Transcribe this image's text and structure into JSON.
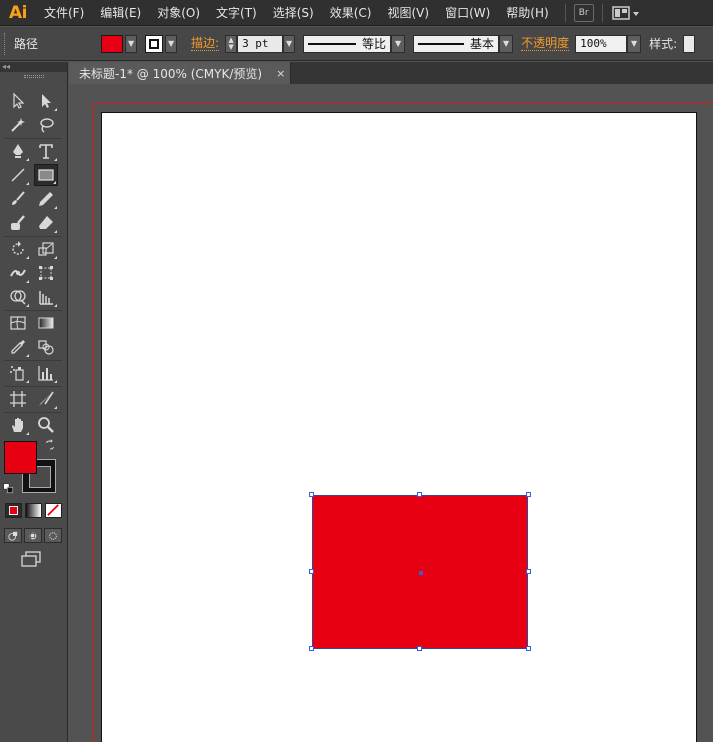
{
  "app": {
    "logo": "Ai"
  },
  "menu": {
    "items": [
      "文件(F)",
      "编辑(E)",
      "对象(O)",
      "文字(T)",
      "选择(S)",
      "效果(C)",
      "视图(V)",
      "窗口(W)",
      "帮助(H)"
    ],
    "bridge_label": "Br"
  },
  "control": {
    "selection_type": "路径",
    "fill_color": "#e60012",
    "stroke_label": "描边:",
    "stroke_weight": "3 pt",
    "profile1": "等比",
    "profile2": "基本",
    "opacity_label": "不透明度",
    "opacity_value": "100%",
    "style_label": "样式:"
  },
  "toolbox": {
    "collapse_label": "◂◂",
    "fill_color": "#e60012",
    "stroke_color": "#111111"
  },
  "document": {
    "tab_title": "未标题-1* @ 100% (CMYK/预览)",
    "close_glyph": "×"
  },
  "artwork": {
    "rectangle_fill": "#e60012",
    "selection_color": "#3b5bd8",
    "bleed_color": "#d21d1d"
  }
}
